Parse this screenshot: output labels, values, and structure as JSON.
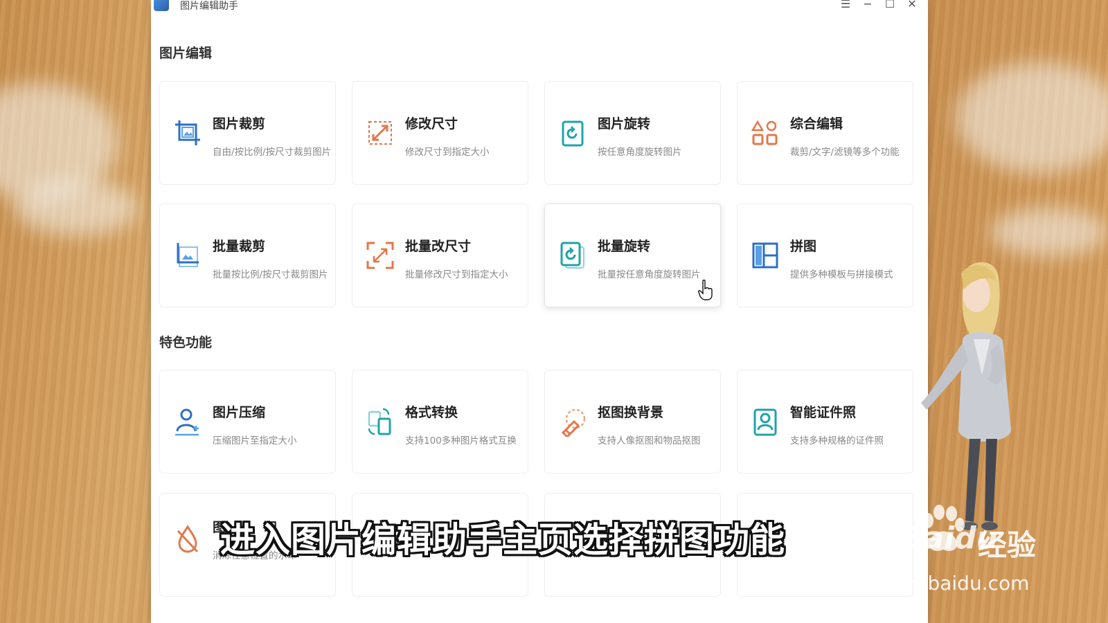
{
  "window": {
    "title": "图片编辑助手",
    "controls": [
      "menu-icon",
      "minimize-icon",
      "maximize-icon",
      "close-icon"
    ]
  },
  "sections": {
    "edit": {
      "title": "图片编辑"
    },
    "featured": {
      "title": "特色功能"
    }
  },
  "cards": [
    {
      "name": "图片裁剪",
      "desc": "自由/按比例/按尺寸裁剪图片",
      "icon": "crop-icon"
    },
    {
      "name": "修改尺寸",
      "desc": "修改尺寸到指定大小",
      "icon": "resize-icon"
    },
    {
      "name": "图片旋转",
      "desc": "按任意角度旋转图片",
      "icon": "rotate-icon"
    },
    {
      "name": "综合编辑",
      "desc": "裁剪/文字/滤镜等多个功能",
      "icon": "shapes-icon"
    },
    {
      "name": "批量裁剪",
      "desc": "批量按比例/按尺寸裁剪图片",
      "icon": "batch-crop-icon"
    },
    {
      "name": "批量改尺寸",
      "desc": "批量修改尺寸到指定大小",
      "icon": "batch-resize-icon"
    },
    {
      "name": "批量旋转",
      "desc": "批量按任意角度旋转图片",
      "icon": "batch-rotate-icon"
    },
    {
      "name": "拼图",
      "desc": "提供多种模板与拼接模式",
      "icon": "collage-icon"
    },
    {
      "name": "图片压缩",
      "desc": "压缩图片至指定大小",
      "icon": "compress-icon"
    },
    {
      "name": "格式转换",
      "desc": "支持100多种图片格式互换",
      "icon": "convert-icon"
    },
    {
      "name": "抠图换背景",
      "desc": "支持人像抠图和物品抠图",
      "icon": "cutout-icon"
    },
    {
      "name": "智能证件照",
      "desc": "支持多种规格的证件照",
      "icon": "id-photo-icon"
    }
  ],
  "partial_row": {
    "first_label": "图",
    "first_label_tail": "印",
    "desc": "消除任意位置的水印"
  },
  "overlay": {
    "subtitle": "进入图片编辑助手主页选择拼图功能",
    "watermark_brand": "Baidu",
    "watermark_suffix": "经验",
    "watermark_url": "jingyan.baidu.com"
  },
  "colors": {
    "blue": "#2b6fc6",
    "orange": "#e2774a",
    "teal": "#1fa3a8"
  }
}
